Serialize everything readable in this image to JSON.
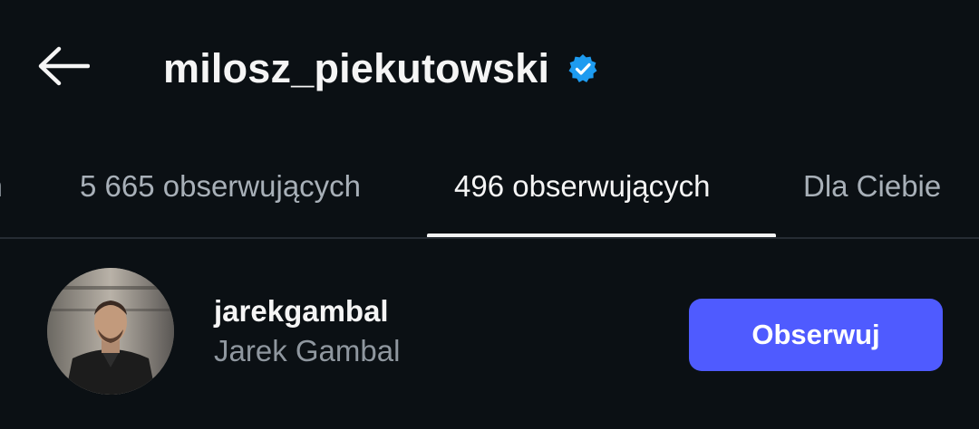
{
  "header": {
    "back_icon": "arrow-left-icon",
    "title": "milosz_piekutowski",
    "verified_icon": "verified-badge-icon",
    "verified_color": "#1d9bf0"
  },
  "tabs": [
    {
      "label": "ch",
      "active": false
    },
    {
      "label": "5 665 obserwujących",
      "active": false
    },
    {
      "label": "496 obserwujących",
      "active": true
    },
    {
      "label": "Dla Ciebie",
      "active": false
    }
  ],
  "list": [
    {
      "username": "jarekgambal",
      "full_name": "Jarek Gambal",
      "button_label": "Obserwuj",
      "button_color": "#4f5bff"
    }
  ]
}
